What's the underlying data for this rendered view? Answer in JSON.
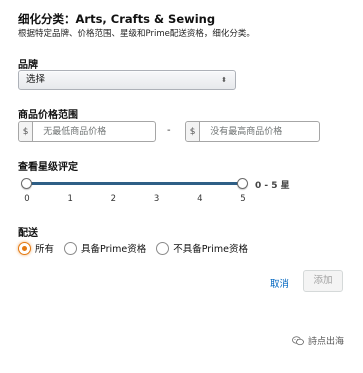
{
  "header": {
    "title": "细化分类：Arts, Crafts & Sewing",
    "subtitle": "根据特定品牌、价格范围、星级和Prime配送资格，细化分类。"
  },
  "brand": {
    "label": "品牌",
    "selected": "选择",
    "arrows": "⬍"
  },
  "price": {
    "label": "商品价格范围",
    "currency": "$",
    "min_placeholder": "无最低商品价格",
    "max_placeholder": "没有最高商品价格",
    "separator": "-"
  },
  "rating": {
    "label": "查看星级评定",
    "range_text": "0 - 5 星",
    "min": 0,
    "max": 5,
    "ticks": [
      "0",
      "1",
      "2",
      "3",
      "4",
      "5"
    ]
  },
  "delivery": {
    "label": "配送",
    "options": [
      {
        "label": "所有",
        "checked": true
      },
      {
        "label": "具备Prime资格",
        "checked": false
      },
      {
        "label": "不具备Prime资格",
        "checked": false
      }
    ]
  },
  "actions": {
    "cancel_label": "取消",
    "add_label": "添加"
  },
  "watermark": {
    "text": "詩点出海",
    "icon": "chat-bubble-icon"
  },
  "colors": {
    "accent": "#e47911",
    "slider": "#2f5f86",
    "link": "#0066c0"
  }
}
